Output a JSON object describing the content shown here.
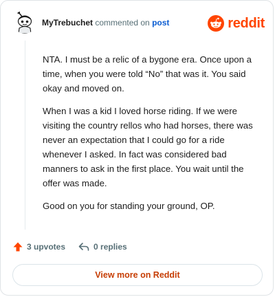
{
  "comment": {
    "author": "MyTrebuchet",
    "action_text": " commented on ",
    "post_link": "post",
    "paragraphs": [
      "NTA. I must be a relic of a bygone era. Once upon a time, when you were told “No” that was it. You said okay and moved on.",
      "When I was a kid I loved horse riding. If we were visiting the country rellos who had horses, there was never an expectation that I could go for a ride whenever I asked. In fact was considered bad manners to ask in the first place. You wait until the offer was made.",
      "Good on you for standing your ground, OP."
    ],
    "upvotes": "3 upvotes",
    "replies": "0 replies"
  },
  "brand": {
    "wordmark": "reddit",
    "color": "#ff4500"
  },
  "footer": {
    "view_more_label": "View more on Reddit"
  },
  "icons": {
    "avatar": "snoo-avatar",
    "logo": "reddit-snoo-icon",
    "upvote": "upvote-arrow-icon",
    "reply": "reply-arrow-icon"
  },
  "colors": {
    "accent": "#ff4500",
    "link": "#0a5cd1",
    "button_text": "#c63d03",
    "muted": "#576f76"
  }
}
